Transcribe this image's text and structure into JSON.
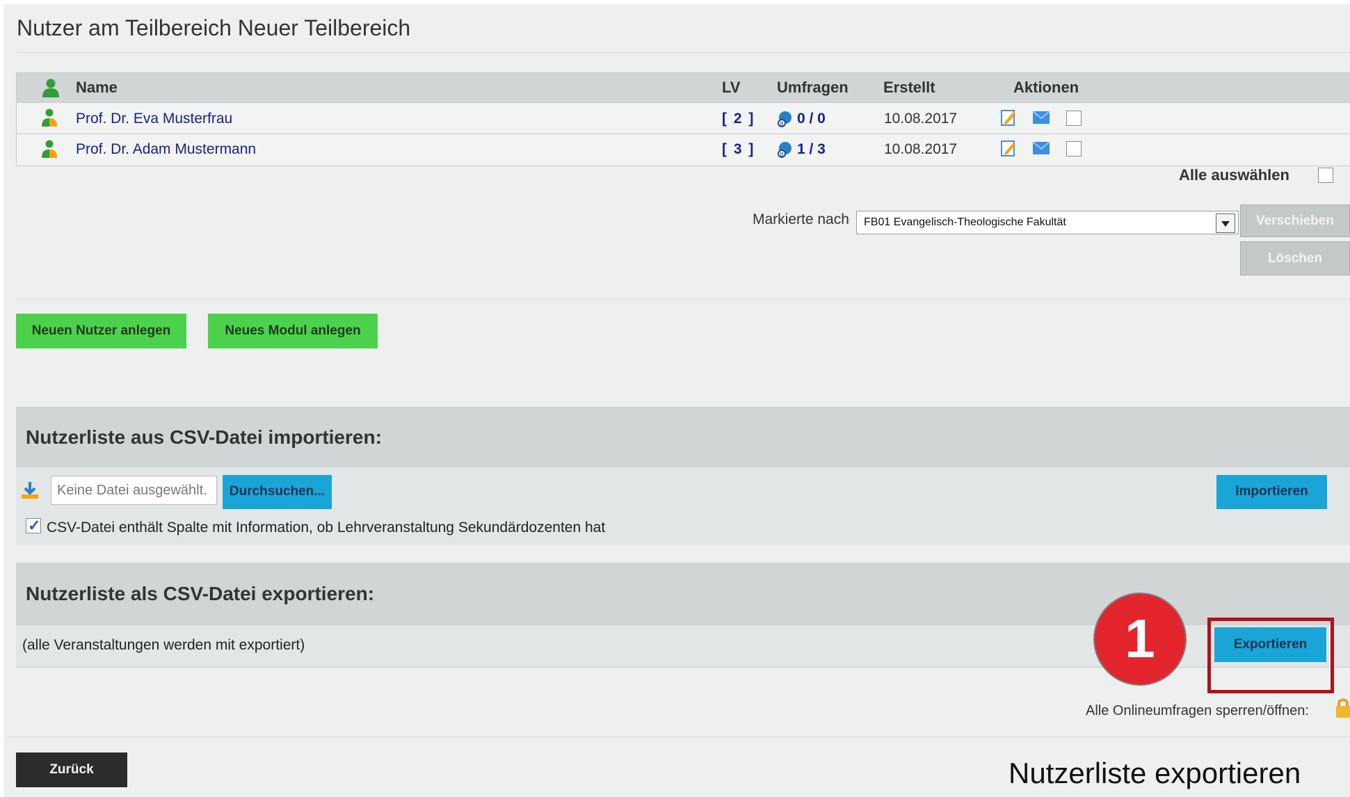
{
  "page": {
    "title": "Nutzer am Teilbereich Neuer Teilbereich"
  },
  "table": {
    "headers": {
      "icon": "user-icon",
      "name": "Name",
      "lv": "LV",
      "umfragen": "Umfragen",
      "erstellt": "Erstellt",
      "aktionen": "Aktionen"
    },
    "rows": [
      {
        "name": "Prof. Dr. Eva Musterfrau",
        "lv": "[ 2 ]",
        "umfragen": "0 / 0",
        "erstellt": "10.08.2017",
        "checked": false
      },
      {
        "name": "Prof. Dr. Adam Mustermann",
        "lv": "[ 3 ]",
        "umfragen": "1 / 3",
        "erstellt": "10.08.2017",
        "checked": false
      }
    ],
    "select_all_label": "Alle auswählen"
  },
  "move": {
    "label": "Markierte nach",
    "selected": "FB01 Evangelisch-Theologische Fakultät",
    "move_button": "Verschieben",
    "delete_button": "Löschen"
  },
  "actions": {
    "new_user": "Neuen Nutzer anlegen",
    "new_module": "Neues Modul anlegen"
  },
  "import": {
    "title": "Nutzerliste aus CSV-Datei importieren:",
    "file_placeholder": "Keine Datei ausgewählt.",
    "browse_button": "Durchsuchen...",
    "import_button": "Importieren",
    "option_label": "CSV-Datei enthält Spalte mit Information, ob Lehrveranstaltung Sekundärdozenten hat",
    "option_checked": true
  },
  "export": {
    "title": "Nutzerliste als CSV-Datei exportieren:",
    "note": "(alle Veranstaltungen werden mit exportiert)",
    "export_button": "Exportieren"
  },
  "annotation": {
    "step_number": "1",
    "caption": "Nutzerliste exportieren",
    "badge_color": "#e3262e",
    "highlight_color": "#b01219"
  },
  "lock": {
    "label": "Alle Onlineumfragen sperren/öffnen:"
  },
  "back_button": "Zurück",
  "colors": {
    "green_button": "#4cd14c",
    "blue_button": "#1aa5d8",
    "header_gray": "#d1d5d6",
    "link_blue": "#1a237e"
  }
}
